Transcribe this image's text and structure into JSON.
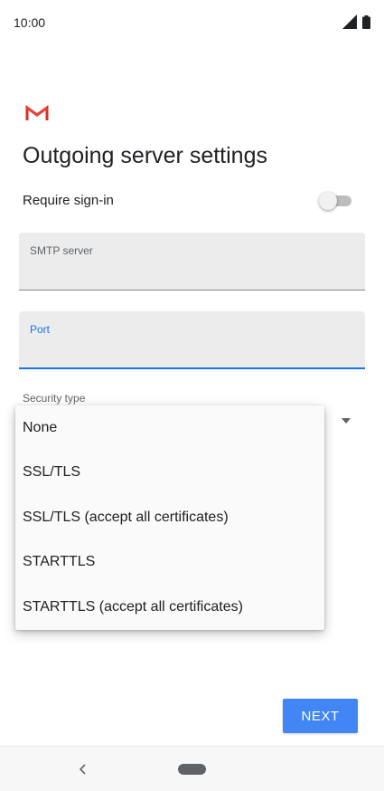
{
  "status_bar": {
    "time": "10:00"
  },
  "header": {
    "title": "Outgoing server settings"
  },
  "sign_in": {
    "label": "Require sign-in",
    "enabled": false
  },
  "fields": {
    "smtp_server": {
      "label": "SMTP server",
      "value": ""
    },
    "port": {
      "label": "Port",
      "value": ""
    }
  },
  "security": {
    "label": "Security type",
    "options": [
      "None",
      "SSL/TLS",
      "SSL/TLS (accept all certificates)",
      "STARTTLS",
      "STARTTLS (accept all certificates)"
    ]
  },
  "actions": {
    "next_label": "NEXT"
  },
  "icons": {
    "signal": "signal-icon",
    "battery": "battery-icon",
    "logo": "gmail-logo-icon",
    "dropdown": "dropdown-arrow-icon",
    "back": "back-icon",
    "home": "home-icon"
  },
  "colors": {
    "accent": "#4285f4",
    "focus": "#1a73e8",
    "field_bg": "#ececec",
    "gmail_red": "#d93025"
  }
}
